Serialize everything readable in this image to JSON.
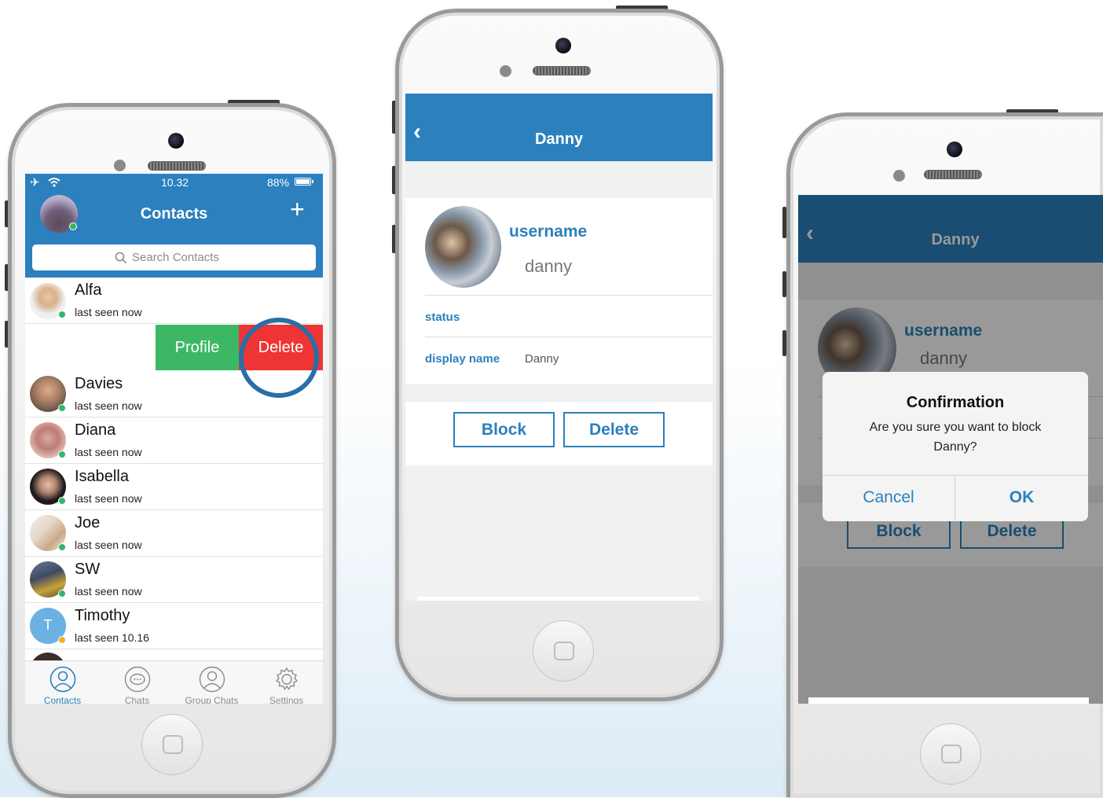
{
  "phone1": {
    "status_bar": {
      "time": "10.32",
      "battery": "88%"
    },
    "title": "Contacts",
    "add_icon": "plus-icon",
    "search_placeholder": "Search Contacts",
    "swipe_actions": {
      "profile": "Profile",
      "delete": "Delete"
    },
    "contacts": [
      {
        "name": "Alfa",
        "seen": "last seen now"
      },
      {
        "name": "Davies",
        "seen": "last seen now"
      },
      {
        "name": "Diana",
        "seen": "last seen now"
      },
      {
        "name": "Isabella",
        "seen": "last seen now"
      },
      {
        "name": "Joe",
        "seen": "last seen now"
      },
      {
        "name": "SW",
        "seen": "last seen now"
      },
      {
        "name": "Timothy",
        "seen": "last seen 10.16",
        "initial": "T"
      }
    ],
    "tabs": [
      {
        "label": "Contacts",
        "icon": "person-icon",
        "active": true
      },
      {
        "label": "Chats",
        "icon": "chat-bubble-icon",
        "active": false
      },
      {
        "label": "Group Chats",
        "icon": "group-icon",
        "active": false
      },
      {
        "label": "Settings",
        "icon": "gear-icon",
        "active": false
      }
    ],
    "colors": {
      "header": "#2b80bd",
      "profile_action": "#3cb865",
      "delete_action": "#ee3434",
      "highlight_ring": "#2a6ea6"
    }
  },
  "phone2": {
    "title": "Danny",
    "back_icon": "chevron-left-icon",
    "username_label": "username",
    "username_value": "danny",
    "status_label": "status",
    "display_name_label": "display name",
    "display_name_value": "Danny",
    "block_button": "Block",
    "delete_button": "Delete"
  },
  "phone3": {
    "title": "Danny",
    "username_label": "username",
    "username_value": "danny",
    "block_button": "Block",
    "delete_button": "Delete",
    "dialog": {
      "title": "Confirmation",
      "message_line1": "Are you sure you want to block",
      "message_line2": "Danny?",
      "cancel": "Cancel",
      "ok": "OK"
    }
  }
}
